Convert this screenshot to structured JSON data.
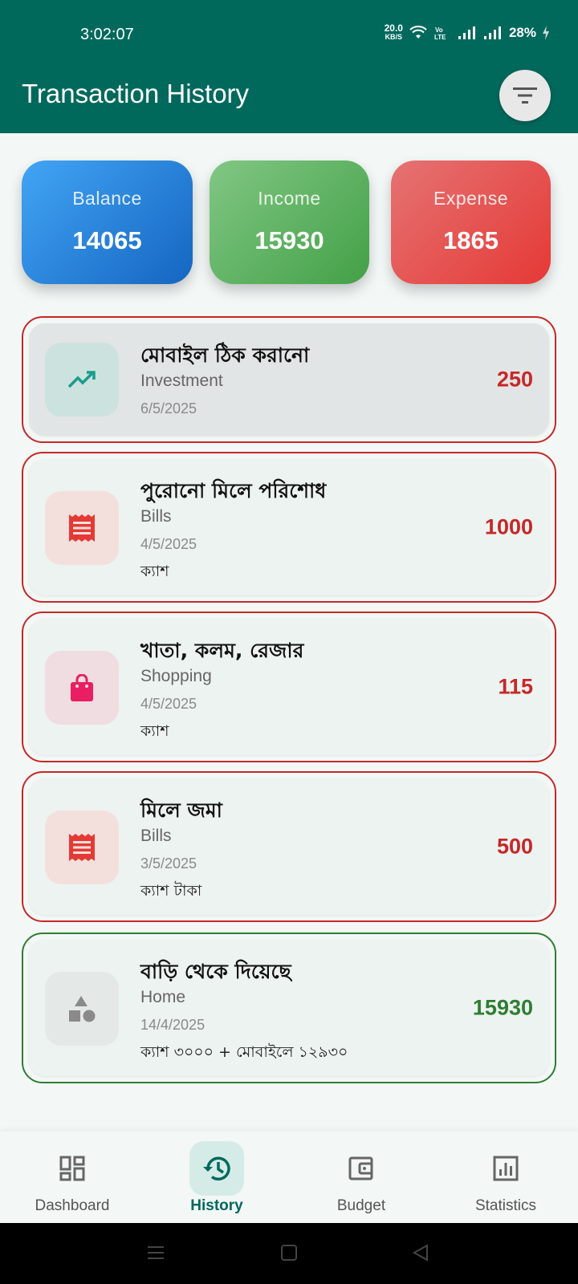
{
  "status_bar": {
    "time": "3:02:07",
    "net_speed": "20.0",
    "net_unit": "KB/S",
    "volte": "Vo LTE",
    "battery": "28%"
  },
  "app_bar": {
    "title": "Transaction History",
    "filter_icon": "filter-list-icon"
  },
  "summary": {
    "balance_label": "Balance",
    "balance_value": "14065",
    "income_label": "Income",
    "income_value": "15930",
    "expense_label": "Expense",
    "expense_value": "1865"
  },
  "colors": {
    "primary": "#00695c",
    "expense": "#c62828",
    "income": "#2e7d32",
    "balance_card": "#1e88e5",
    "income_card": "#4caf50",
    "expense_card": "#e53935"
  },
  "transactions": [
    {
      "title": "মোবাইল ঠিক করানো",
      "category": "Investment",
      "date": "6/5/2025",
      "note": "",
      "amount": "250",
      "type": "expense",
      "icon": "trending-up-icon"
    },
    {
      "title": "পুরোনো মিলে পরিশোধ",
      "category": "Bills",
      "date": "4/5/2025",
      "note": "ক্যাশ",
      "amount": "1000",
      "type": "expense",
      "icon": "receipt-icon"
    },
    {
      "title": "খাতা, কলম, রেজার",
      "category": "Shopping",
      "date": "4/5/2025",
      "note": "ক্যাশ",
      "amount": "115",
      "type": "expense",
      "icon": "shopping-bag-icon"
    },
    {
      "title": "মিলে জমা",
      "category": "Bills",
      "date": "3/5/2025",
      "note": "ক্যাশ টাকা",
      "amount": "500",
      "type": "expense",
      "icon": "receipt-icon"
    },
    {
      "title": "বাড়ি থেকে দিয়েছে",
      "category": "Home",
      "date": "14/4/2025",
      "note": "ক্যাশ ৩০০০ + মোবাইলে ১২৯৩০",
      "amount": "15930",
      "type": "income",
      "icon": "category-shapes-icon"
    }
  ],
  "bottom_nav": {
    "items": [
      {
        "label": "Dashboard",
        "icon": "dashboard-icon"
      },
      {
        "label": "History",
        "icon": "history-icon",
        "active": true
      },
      {
        "label": "Budget",
        "icon": "wallet-icon"
      },
      {
        "label": "Statistics",
        "icon": "bar-chart-icon"
      }
    ]
  }
}
